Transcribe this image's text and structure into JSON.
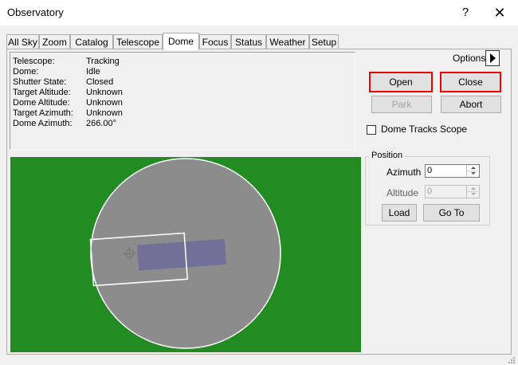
{
  "window": {
    "title": "Observatory",
    "help_glyph": "?",
    "close_glyph": "✕"
  },
  "tabs": [
    {
      "label": "All Sky"
    },
    {
      "label": "Zoom"
    },
    {
      "label": "Catalog"
    },
    {
      "label": "Telescope"
    },
    {
      "label": "Dome",
      "active": true
    },
    {
      "label": "Focus"
    },
    {
      "label": "Status"
    },
    {
      "label": "Weather"
    },
    {
      "label": "Setup"
    }
  ],
  "status": [
    {
      "key": "Telescope:",
      "value": "Tracking"
    },
    {
      "key": "Dome:",
      "value": "Idle"
    },
    {
      "key": "Shutter State:",
      "value": "Closed"
    },
    {
      "key": "Target Altitude:",
      "value": "Unknown"
    },
    {
      "key": "Dome Altitude:",
      "value": "Unknown"
    },
    {
      "key": "Target Azimuth:",
      "value": "Unknown"
    },
    {
      "key": "Dome Azimuth:",
      "value": "266.00°"
    }
  ],
  "controls": {
    "options_label": "Options",
    "open_label": "Open",
    "close_label": "Close",
    "park_label": "Park",
    "abort_label": "Abort",
    "dome_tracks_label": "Dome Tracks Scope",
    "dome_tracks_checked": false
  },
  "position": {
    "title": "Position",
    "azimuth_label": "Azimuth",
    "azimuth_value": "0",
    "altitude_label": "Altitude",
    "altitude_value": "0",
    "load_label": "Load",
    "goto_label": "Go To"
  },
  "colors": {
    "sky_background": "#228b22",
    "dome_fill": "#8c8c8c",
    "telescope_fill": "#6b6b9a",
    "highlight_border": "#e00000"
  }
}
